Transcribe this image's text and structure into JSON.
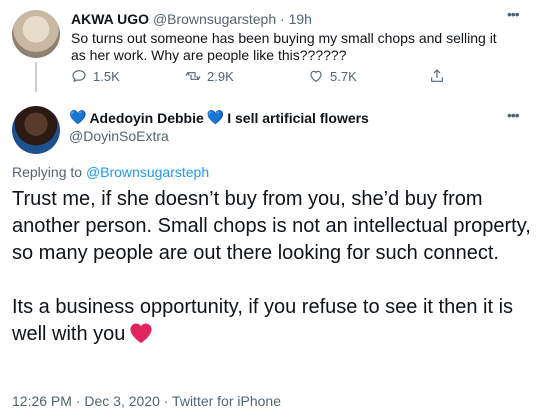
{
  "parent_tweet": {
    "name": "AKWA UGO",
    "handle": "@Brownsugarsteph",
    "separator": "·",
    "time": "19h",
    "text": "So turns out someone has been buying my small chops and selling it as her work. Why are people like this??????",
    "actions": {
      "replies": "1.5K",
      "retweets": "2.9K",
      "likes": "5.7K"
    }
  },
  "reply_tweet": {
    "name_prefix": "Adedoyin Debbie",
    "name_suffix": "I sell artificial flowers",
    "handle": "@DoyinSoExtra",
    "replying_label": "Replying to",
    "replying_to": "@Brownsugarsteph",
    "body_p1": "Trust me, if she doesn’t buy from you, she’d buy from another person. Small chops is not an intellectual property, so many people are out there looking for such connect.",
    "body_p2": "Its a business opportunity, if you refuse to see it then it is well with you",
    "timestamp": "12:26 PM · Dec 3, 2020 · Twitter for iPhone"
  },
  "colors": {
    "accent": "#1d9bf0",
    "muted": "#536471",
    "heart_red": "#e0245e"
  },
  "icons": [
    "reply-icon",
    "retweet-icon",
    "like-icon",
    "share-icon",
    "more-icon",
    "blue-heart-icon",
    "red-heart-icon"
  ]
}
